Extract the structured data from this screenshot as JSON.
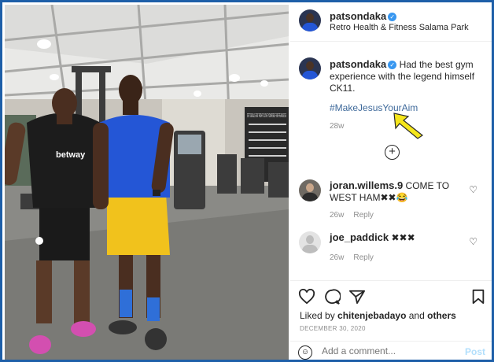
{
  "header": {
    "username": "patsondaka",
    "location": "Retro Health & Fitness Salama Park"
  },
  "caption": {
    "username": "patsondaka",
    "text": "Had the best gym experience with the legend himself CK11.",
    "hashtag": "#MakeJesusYourAim",
    "age": "28w"
  },
  "photo": {
    "sign_text": "SET GOALS EAT RIGHT LOVE YOURSELF BE FEARLESS",
    "shirt_brand": "betway"
  },
  "comments": [
    {
      "username": "joran.willems.9",
      "text": "COME TO WEST HAM✖✖😂",
      "age": "26w",
      "reply": "Reply"
    },
    {
      "username": "joe_paddick",
      "text": "✖✖✖",
      "age": "26w",
      "reply": "Reply"
    }
  ],
  "likes": {
    "prefix": "Liked by",
    "user": "chitenjebadayo",
    "joiner": "and",
    "others": "others"
  },
  "date": "DECEMBER 30, 2020",
  "add_comment": {
    "placeholder": "Add a comment...",
    "post_label": "Post"
  },
  "colors": {
    "frame": "#1e5fa8",
    "verified": "#3897f0",
    "hashtag": "#3f6a9b",
    "arrow": "#f5e61c"
  },
  "icons": [
    "verified-icon",
    "add-icon",
    "heart-icon",
    "comment-icon",
    "share-icon",
    "bookmark-icon",
    "emoji-icon",
    "arrow-icon"
  ]
}
